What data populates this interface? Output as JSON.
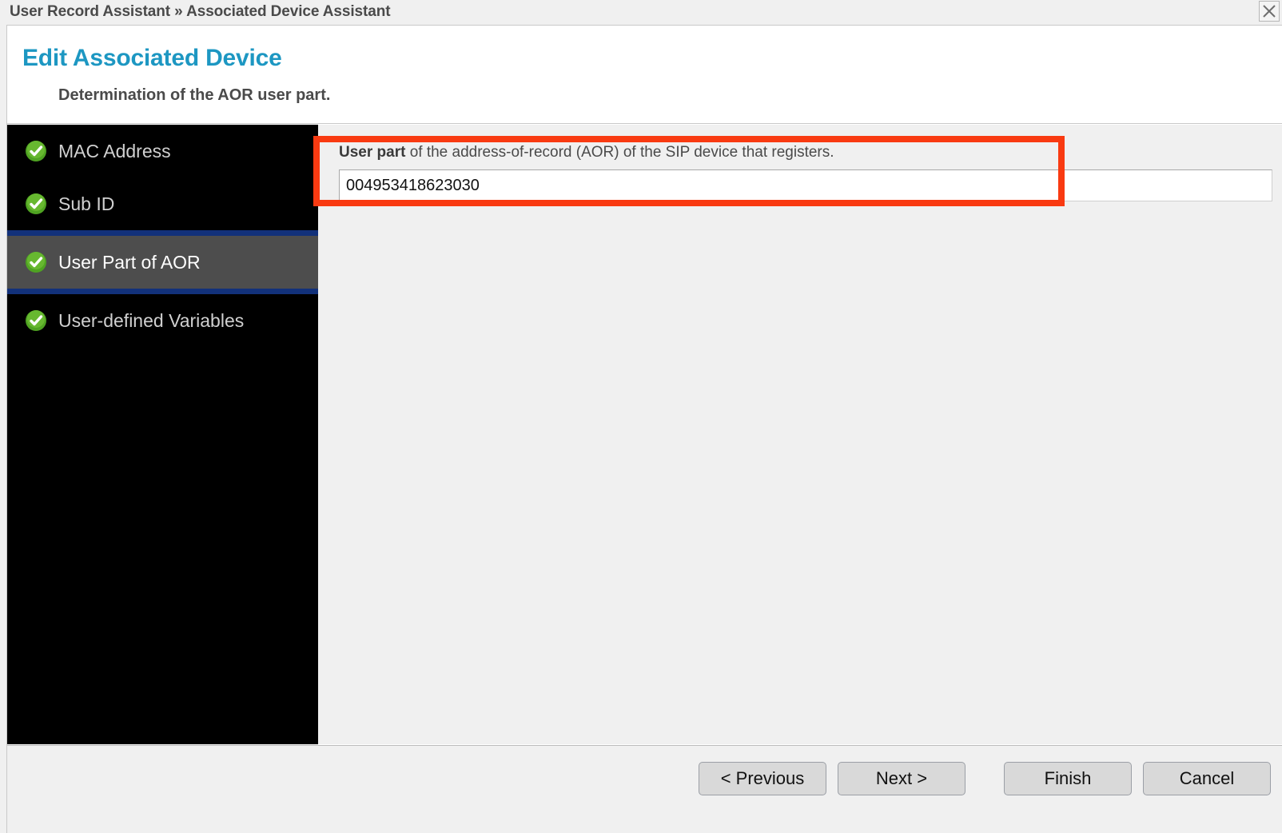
{
  "titlebar": {
    "breadcrumb": "User Record Assistant » Associated Device Assistant",
    "close_icon": "close-icon"
  },
  "header": {
    "title": "Edit Associated Device",
    "subtitle": "Determination of the AOR user part."
  },
  "sidebar": {
    "items": [
      {
        "label": "MAC Address",
        "icon": "check-circle-icon",
        "selected": false
      },
      {
        "label": "Sub ID",
        "icon": "check-circle-icon",
        "selected": false
      },
      {
        "label": "User Part of AOR",
        "icon": "check-circle-icon",
        "selected": true
      },
      {
        "label": "User-defined Variables",
        "icon": "check-circle-icon",
        "selected": false
      }
    ]
  },
  "main": {
    "field_label_strong": "User part",
    "field_label_rest": " of the address-of-record (AOR) of the SIP device that registers.",
    "field_value": "004953418623030",
    "field_placeholder": ""
  },
  "footer": {
    "buttons": [
      {
        "label": "< Previous",
        "name": "previous-button"
      },
      {
        "label": "Next >",
        "name": "next-button"
      },
      {
        "label": "Finish",
        "name": "finish-button"
      },
      {
        "label": "Cancel",
        "name": "cancel-button"
      }
    ]
  },
  "colors": {
    "title_accent": "#1d97c2",
    "highlight": "#f93a11",
    "sidebar_bg": "#000000",
    "sidebar_selected": "#4d4d4d",
    "sidebar_separator": "#12317a",
    "check_green": "#4fa322"
  }
}
